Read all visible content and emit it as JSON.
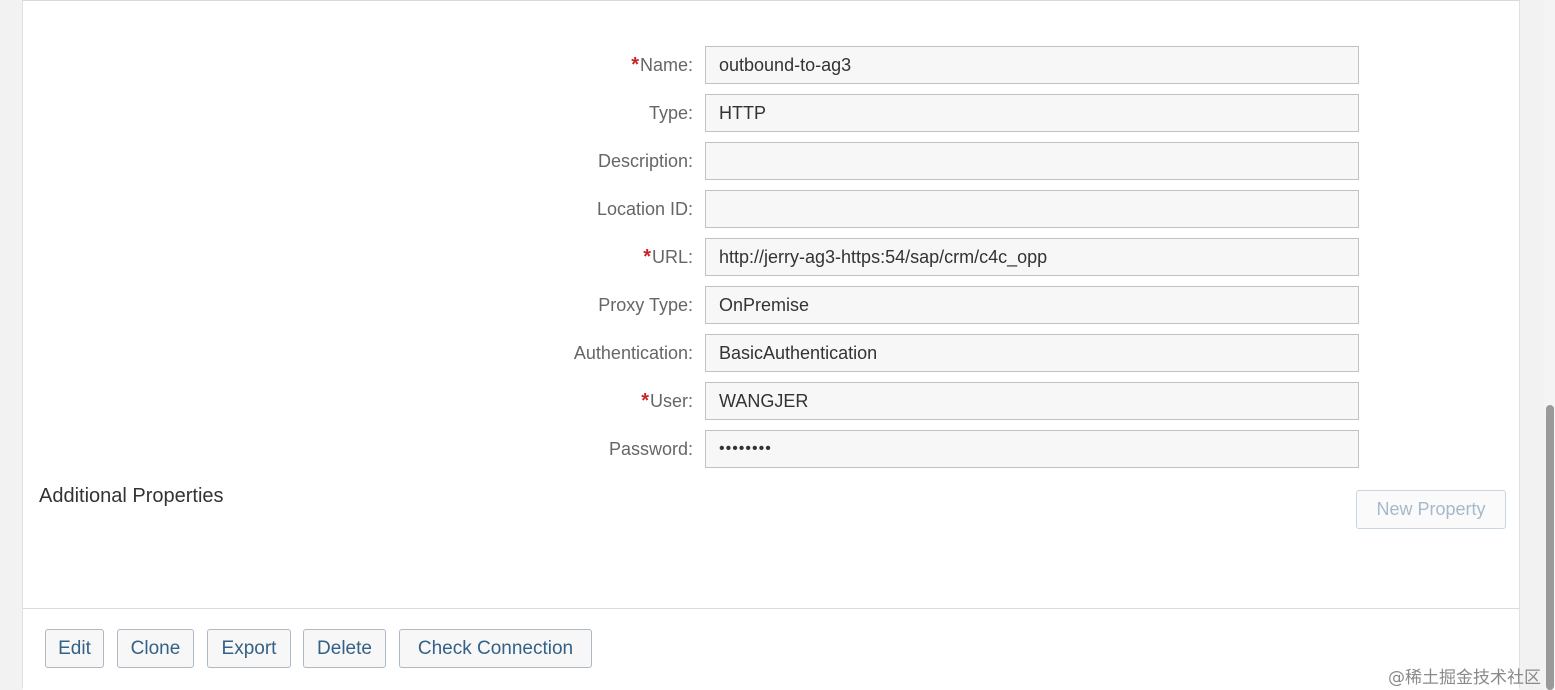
{
  "form": {
    "fields": [
      {
        "label": "Name:",
        "required": true,
        "value": "outbound-to-ag3"
      },
      {
        "label": "Type:",
        "required": false,
        "value": "HTTP"
      },
      {
        "label": "Description:",
        "required": false,
        "value": ""
      },
      {
        "label": "Location ID:",
        "required": false,
        "value": ""
      },
      {
        "label": "URL:",
        "required": true,
        "value": "http://jerry-ag3-https:54/sap/crm/c4c_opp"
      },
      {
        "label": "Proxy Type:",
        "required": false,
        "value": "OnPremise"
      },
      {
        "label": "Authentication:",
        "required": false,
        "value": "BasicAuthentication"
      },
      {
        "label": "User:",
        "required": true,
        "value": "WANGJER"
      },
      {
        "label": "Password:",
        "required": false,
        "value": "••••••••"
      }
    ],
    "required_marker": "*"
  },
  "additional_properties": {
    "title": "Additional Properties",
    "new_property_label": "New Property"
  },
  "footer": {
    "edit": "Edit",
    "clone": "Clone",
    "export": "Export",
    "delete": "Delete",
    "check_connection": "Check Connection"
  },
  "watermark": "@稀土掘金技术社区",
  "colors": {
    "required": "#c7252a",
    "button_text": "#346187",
    "disabled_text": "#a6b9cc"
  }
}
